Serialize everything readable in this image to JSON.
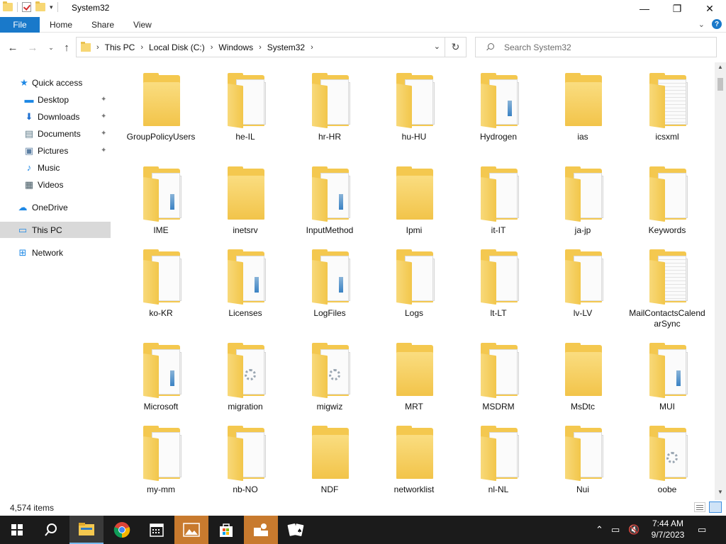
{
  "window": {
    "title": "System32",
    "minimize": "—",
    "maximize": "❐",
    "close": "✕"
  },
  "ribbon": {
    "file": "File",
    "home": "Home",
    "share": "Share",
    "view": "View",
    "expand": "⌄",
    "help": "?"
  },
  "nav": {
    "back": "←",
    "forward": "→",
    "history": "⌄",
    "up": "↑",
    "breadcrumbs": [
      "This PC",
      "Local Disk (C:)",
      "Windows",
      "System32"
    ],
    "separator": "›",
    "dropdown": "⌄",
    "refresh": "↻",
    "search_placeholder": "Search System32"
  },
  "sidebar": {
    "items": [
      {
        "label": "Quick access",
        "icon": "star-icon",
        "glyph": "★",
        "color": "#1e88e5",
        "pinned": false
      },
      {
        "label": "Desktop",
        "icon": "desktop-icon",
        "glyph": "▬",
        "color": "#1e88e5",
        "pinned": true
      },
      {
        "label": "Downloads",
        "icon": "download-icon",
        "glyph": "⬇",
        "color": "#1e6fd0",
        "pinned": true
      },
      {
        "label": "Documents",
        "icon": "documents-icon",
        "glyph": "▤",
        "color": "#607d8b",
        "pinned": true
      },
      {
        "label": "Pictures",
        "icon": "pictures-icon",
        "glyph": "▣",
        "color": "#5c7fa3",
        "pinned": true
      },
      {
        "label": "Music",
        "icon": "music-icon",
        "glyph": "♪",
        "color": "#1e88e5",
        "pinned": false
      },
      {
        "label": "Videos",
        "icon": "videos-icon",
        "glyph": "▦",
        "color": "#455a64",
        "pinned": false
      },
      {
        "label": "OneDrive",
        "icon": "onedrive-icon",
        "glyph": "☁",
        "color": "#1e88e5",
        "pinned": false
      },
      {
        "label": "This PC",
        "icon": "this-pc-icon",
        "glyph": "▭",
        "color": "#1e88e5",
        "pinned": false
      },
      {
        "label": "Network",
        "icon": "network-icon",
        "glyph": "⊞",
        "color": "#1e88e5",
        "pinned": false
      }
    ],
    "pin_glyph": "📌"
  },
  "folders": [
    {
      "name": "GroupPolicyUsers",
      "style": "plain"
    },
    {
      "name": "he-IL",
      "style": "papers"
    },
    {
      "name": "hr-HR",
      "style": "papers"
    },
    {
      "name": "hu-HU",
      "style": "papers"
    },
    {
      "name": "Hydrogen",
      "style": "stripe"
    },
    {
      "name": "ias",
      "style": "plain"
    },
    {
      "name": "icsxml",
      "style": "doc"
    },
    {
      "name": "IME",
      "style": "stripe"
    },
    {
      "name": "inetsrv",
      "style": "plain"
    },
    {
      "name": "InputMethod",
      "style": "stripe"
    },
    {
      "name": "Ipmi",
      "style": "plain"
    },
    {
      "name": "it-IT",
      "style": "papers"
    },
    {
      "name": "ja-jp",
      "style": "papers"
    },
    {
      "name": "Keywords",
      "style": "papers"
    },
    {
      "name": "ko-KR",
      "style": "papers"
    },
    {
      "name": "Licenses",
      "style": "stripe"
    },
    {
      "name": "LogFiles",
      "style": "stripe"
    },
    {
      "name": "Logs",
      "style": "papers"
    },
    {
      "name": "lt-LT",
      "style": "papers"
    },
    {
      "name": "lv-LV",
      "style": "papers"
    },
    {
      "name": "MailContactsCalendarSync",
      "style": "doc"
    },
    {
      "name": "Microsoft",
      "style": "stripe"
    },
    {
      "name": "migration",
      "style": "gear"
    },
    {
      "name": "migwiz",
      "style": "gear"
    },
    {
      "name": "MRT",
      "style": "plain"
    },
    {
      "name": "MSDRM",
      "style": "papers"
    },
    {
      "name": "MsDtc",
      "style": "plain"
    },
    {
      "name": "MUI",
      "style": "stripe"
    },
    {
      "name": "my-mm",
      "style": "papers"
    },
    {
      "name": "nb-NO",
      "style": "papers"
    },
    {
      "name": "NDF",
      "style": "plain"
    },
    {
      "name": "networklist",
      "style": "plain"
    },
    {
      "name": "nl-NL",
      "style": "papers"
    },
    {
      "name": "Nui",
      "style": "papers"
    },
    {
      "name": "oobe",
      "style": "gear"
    }
  ],
  "status": {
    "item_count": "4,574 items"
  },
  "taskbar": {
    "time": "7:44 AM",
    "date": "9/7/2023"
  }
}
